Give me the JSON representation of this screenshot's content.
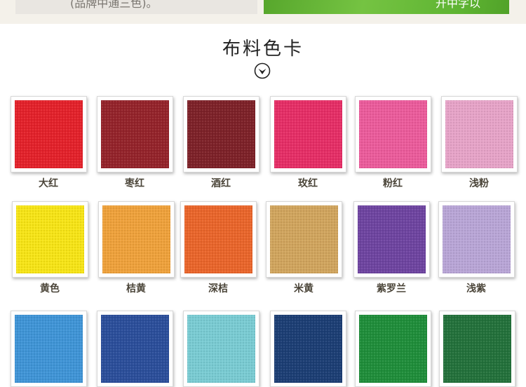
{
  "top_banner": {
    "left_text": "(品牌中通三色)。",
    "right_text": "开中字以"
  },
  "section": {
    "title": "布料色卡"
  },
  "swatches": [
    {
      "label": "大红",
      "color": "#e3212a"
    },
    {
      "label": "枣红",
      "color": "#94232a"
    },
    {
      "label": "酒红",
      "color": "#7d2128"
    },
    {
      "label": "玫红",
      "color": "#e52e66"
    },
    {
      "label": "粉红",
      "color": "#eb5b9b"
    },
    {
      "label": "浅粉",
      "color": "#e6a3c7"
    },
    {
      "label": "黄色",
      "color": "#f6e416"
    },
    {
      "label": "桔黄",
      "color": "#eea13b"
    },
    {
      "label": "深桔",
      "color": "#e9652a"
    },
    {
      "label": "米黄",
      "color": "#d0a45d"
    },
    {
      "label": "紫罗兰",
      "color": "#6e44a0"
    },
    {
      "label": "浅紫",
      "color": "#b8a5d6"
    },
    {
      "label": "",
      "color": "#3f94d6"
    },
    {
      "label": "",
      "color": "#2b4e9a"
    },
    {
      "label": "",
      "color": "#79cbd2"
    },
    {
      "label": "",
      "color": "#1c3e74"
    },
    {
      "label": "",
      "color": "#1f8d3a"
    },
    {
      "label": "",
      "color": "#23713b"
    }
  ]
}
